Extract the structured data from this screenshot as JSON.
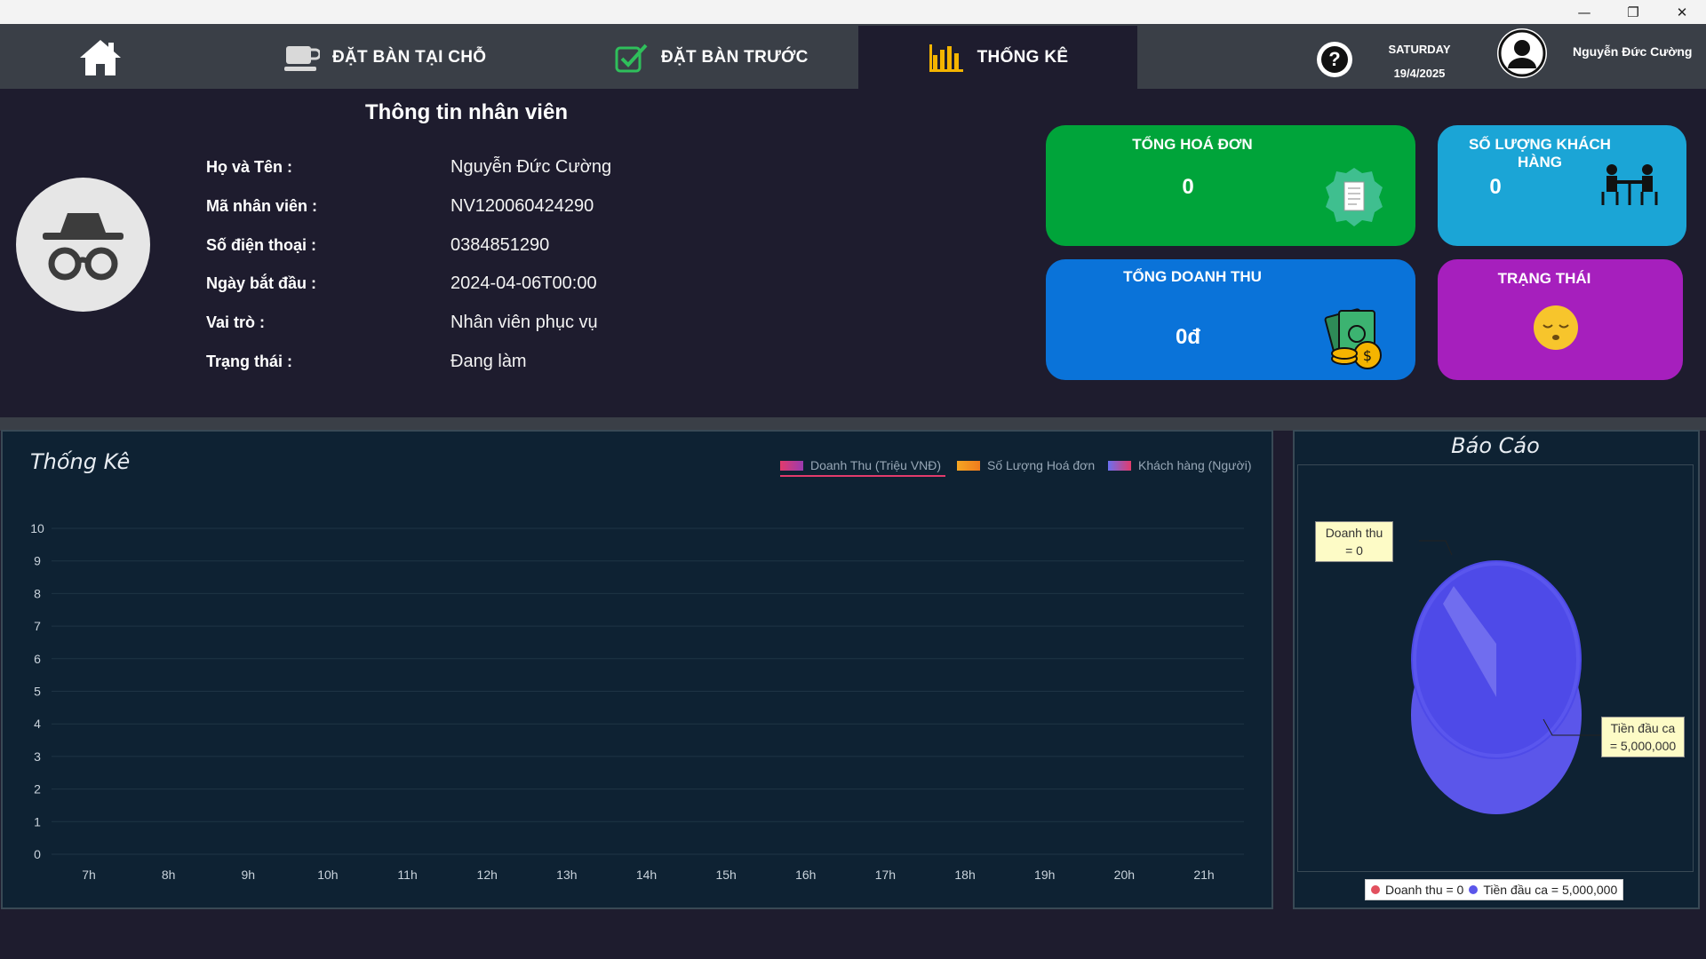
{
  "window": {
    "minimize": "—",
    "restore": "❐",
    "close": "✕"
  },
  "nav": {
    "home_icon": "home-icon",
    "items": [
      {
        "label": "ĐẶT BÀN TẠI CHỖ",
        "icon": "coffee-cup-icon"
      },
      {
        "label": "ĐẶT BÀN TRƯỚC",
        "icon": "checkbox-icon"
      },
      {
        "label": "THỐNG KÊ",
        "icon": "bar-chart-icon",
        "active": true
      }
    ],
    "help": "?",
    "day": "SATURDAY",
    "date": "19/4/2025",
    "user": "Nguyễn Đức Cường"
  },
  "info": {
    "title": "Thông tin nhân viên",
    "rows": [
      {
        "label": "Họ và Tên      :",
        "value": "Nguyễn Đức Cường"
      },
      {
        "label": "Mã nhân viên :",
        "value": "NV120060424290"
      },
      {
        "label": "Số điện thoại  :",
        "value": "0384851290"
      },
      {
        "label": "Ngày bắt đầu :",
        "value": "2024-04-06T00:00"
      },
      {
        "label": "Vai trò           :",
        "value": "Nhân viên phục vụ"
      },
      {
        "label": "Trạng thái      :",
        "value": "Đang làm"
      }
    ]
  },
  "cards": {
    "invoices": {
      "title": "TỔNG HOÁ ĐƠN",
      "value": "0",
      "color": "#00a43a"
    },
    "customers": {
      "title": "SỐ LƯỢNG KHÁCH HÀNG",
      "value": "0",
      "color": "#1ba5d6"
    },
    "revenue": {
      "title": "TỔNG DOANH THU",
      "value": "0đ",
      "color": "#0a73d9"
    },
    "status": {
      "title": "TRẠNG THÁI",
      "color": "#a61fbd"
    }
  },
  "stats_panel": {
    "title": "Thống Kê",
    "legend": [
      {
        "label": "Doanh Thu (Triệu VNĐ)",
        "color": "#e23b6c"
      },
      {
        "label": "Số Lượng Hoá đơn",
        "color": "#f5a623"
      },
      {
        "label": "Khách hàng (Người)",
        "color": "#6b6ff0"
      }
    ]
  },
  "report_panel": {
    "title": "Báo Cáo",
    "callout_revenue": [
      "Doanh thu",
      "= 0"
    ],
    "callout_cash": [
      "Tiền đầu ca",
      "= 5,000,000"
    ],
    "legend_revenue": "Doanh thu = 0",
    "legend_cash": "Tiền đầu ca = 5,000,000"
  },
  "chart_data": [
    {
      "type": "line",
      "title": "Thống Kê",
      "x": [
        "7h",
        "8h",
        "9h",
        "10h",
        "11h",
        "12h",
        "13h",
        "14h",
        "15h",
        "16h",
        "17h",
        "18h",
        "19h",
        "20h",
        "21h"
      ],
      "y_ticks": [
        "0",
        "1",
        "2",
        "3",
        "4",
        "5",
        "6",
        "7",
        "8",
        "9",
        "10"
      ],
      "ylim": [
        0,
        10
      ],
      "grid": true,
      "legend_position": "top-right",
      "series": [
        {
          "name": "Doanh Thu (Triệu VNĐ)",
          "values": [
            0,
            0,
            0,
            0,
            0,
            0,
            0,
            0,
            0,
            0,
            0,
            0,
            0,
            0,
            0
          ]
        },
        {
          "name": "Số Lượng Hoá đơn",
          "values": [
            0,
            0,
            0,
            0,
            0,
            0,
            0,
            0,
            0,
            0,
            0,
            0,
            0,
            0,
            0
          ]
        },
        {
          "name": "Khách hàng (Người)",
          "values": [
            0,
            0,
            0,
            0,
            0,
            0,
            0,
            0,
            0,
            0,
            0,
            0,
            0,
            0,
            0
          ]
        }
      ]
    },
    {
      "type": "pie",
      "title": "Báo Cáo",
      "labels": [
        "Doanh thu",
        "Tiền đầu ca"
      ],
      "values": [
        0,
        5000000
      ],
      "colors": [
        "#e2505e",
        "#5b56ea"
      ],
      "legend_position": "bottom"
    }
  ]
}
